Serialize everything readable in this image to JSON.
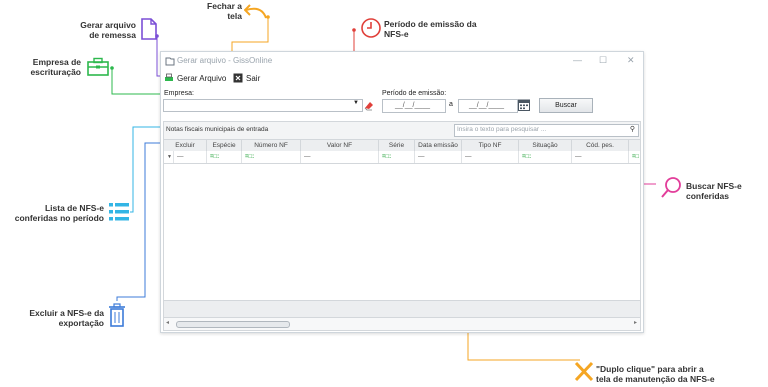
{
  "window": {
    "title": "Gerar arquivo - GissOnline",
    "menu": {
      "gerar": "Gerar Arquivo",
      "sair": "Sair"
    }
  },
  "form": {
    "empresa_label": "Empresa:",
    "periodo_label": "Período de emissão:",
    "date_placeholder": "__/__/____",
    "a_label": "a",
    "buscar_label": "Buscar"
  },
  "grid": {
    "group_label": "Notas fiscais municipais de entrada",
    "search_placeholder": "Insira o texto para pesquisar ...",
    "columns": [
      "Excluir",
      "Espécie",
      "Número NF",
      "Valor NF",
      "Série",
      "Data emissão",
      "Tipo NF",
      "Situação",
      "Cód. pes."
    ],
    "filter_row": [
      "—",
      "",
      "",
      "—",
      "",
      "—",
      "—",
      "",
      "—"
    ]
  },
  "callouts": {
    "fechar": "Fechar a\ntela",
    "gerar_remessa": "Gerar arquivo\nde remessa",
    "periodo": "Período de emissão da\nNFS-e",
    "empresa": "Empresa de\nescrituração",
    "buscar": "Buscar NFS-e\nconferidas",
    "lista": "Lista de NFS-e\nconferidas no período",
    "excluir": "Excluir a NFS-e da\nexportação",
    "duplo": "\"Duplo clique\" para abrir a\ntela de manutenção da NFS-e"
  },
  "colors": {
    "purple": "#7b4fd6",
    "orange": "#f5a623",
    "red": "#e0403a",
    "green": "#2db84d",
    "pink": "#e23d9a",
    "blue": "#3c7bd9",
    "cyan": "#33b5e5"
  }
}
